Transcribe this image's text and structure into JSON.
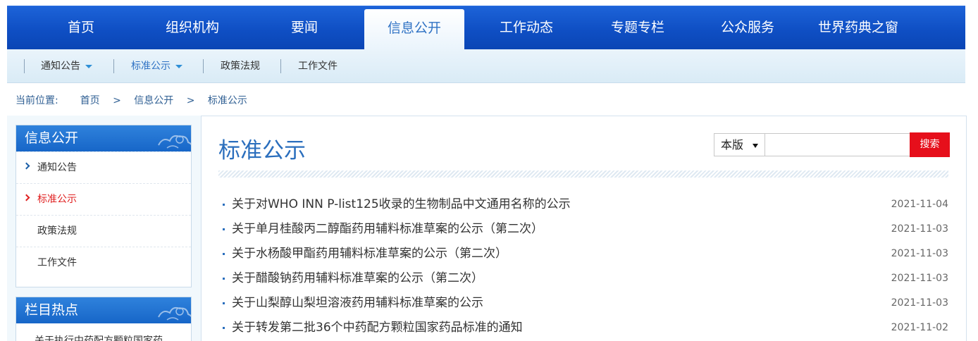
{
  "topnav": {
    "items": [
      {
        "label": "首页"
      },
      {
        "label": "组织机构"
      },
      {
        "label": "要闻"
      },
      {
        "label": "信息公开"
      },
      {
        "label": "工作动态"
      },
      {
        "label": "专题专栏"
      },
      {
        "label": "公众服务"
      },
      {
        "label": "世界药典之窗"
      }
    ],
    "active": "信息公开"
  },
  "subnav": {
    "items": [
      {
        "label": "通知公告",
        "has_dropdown": true
      },
      {
        "label": "标准公示",
        "has_dropdown": true
      },
      {
        "label": "政策法规",
        "has_dropdown": false
      },
      {
        "label": "工作文件",
        "has_dropdown": false
      }
    ],
    "active": "标准公示"
  },
  "breadcrumb": {
    "prefix": "当前位置:",
    "items": [
      "首页",
      "信息公开",
      "标准公示"
    ],
    "separator": ">"
  },
  "sidebar": {
    "section_title": "信息公开",
    "items": [
      {
        "label": "通知公告"
      },
      {
        "label": "标准公示"
      },
      {
        "label": "政策法规"
      },
      {
        "label": "工作文件"
      }
    ],
    "active": "标准公示",
    "hot_title": "栏目热点",
    "hot_items": [
      {
        "label": "关于执行中药配方颗粒国家药"
      }
    ]
  },
  "main": {
    "title": "标准公示",
    "search": {
      "scope": "本版",
      "placeholder": "",
      "button": "搜索"
    },
    "list": [
      {
        "title": "关于对WHO INN P-list125收录的生物制品中文通用名称的公示",
        "date": "2021-11-04"
      },
      {
        "title": "关于单月桂酸丙二醇酯药用辅料标准草案的公示（第二次）",
        "date": "2021-11-03"
      },
      {
        "title": "关于水杨酸甲酯药用辅料标准草案的公示（第二次）",
        "date": "2021-11-03"
      },
      {
        "title": "关于醋酸钠药用辅料标准草案的公示（第二次）",
        "date": "2021-11-03"
      },
      {
        "title": "关于山梨醇山梨坦溶液药用辅料标准草案的公示",
        "date": "2021-11-03"
      },
      {
        "title": "关于转发第二批36个中药配方颗粒国家药品标准的通知",
        "date": "2021-11-02"
      }
    ]
  },
  "colors": {
    "nav_blue": "#0f4fc4",
    "accent_blue": "#2a6ebd",
    "search_red": "#e60f1b",
    "active_red": "#e02020"
  }
}
